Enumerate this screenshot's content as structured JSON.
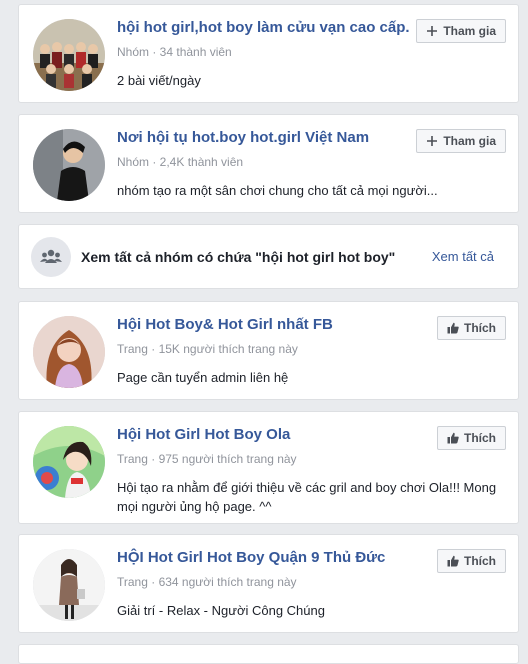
{
  "groups": [
    {
      "name": "hội hot girl,hot boy làm cửu vạn cao cấp.",
      "meta": "Nhóm · 34 thành viên",
      "desc": "2 bài viết/ngày",
      "button": "Tham gia",
      "avatar": "group-photo"
    },
    {
      "name": "Nơi hội tụ hot.boy hot.girl Việt Nam",
      "meta": "Nhóm · 2,4K thành viên",
      "desc": "nhóm tạo ra một sân chơi chung cho tất cả mọi người...",
      "button": "Tham gia",
      "avatar": "person-photo"
    }
  ],
  "see_all": {
    "text": "Xem tất cả nhóm có chứa \"hội hot girl hot boy\"",
    "link": "Xem tất cả",
    "icon": "group-icon"
  },
  "pages": [
    {
      "name": "Hội Hot Boy& Hot Girl nhất FB",
      "meta": "Trang · 15K người thích trang này",
      "desc": "Page cần tuyển admin liên hệ",
      "button": "Thích",
      "avatar": "girl-photo"
    },
    {
      "name": "Hội Hot Girl Hot Boy Ola",
      "meta": "Trang · 975 người thích trang này",
      "desc": "Hội tạo ra nhằm để giới thiệu về các gril and boy chơi Ola!!! Mong mọi người ủng hộ page. ^^",
      "button": "Thích",
      "avatar": "anime-photo"
    },
    {
      "name": "HỘI Hot Girl Hot Boy Quận 9 Thủ Đức",
      "meta": "Trang · 634 người thích trang này",
      "desc": "Giải trí - Relax - Người Công Chúng",
      "button": "Thích",
      "avatar": "woman-photo"
    }
  ],
  "colors": {
    "link": "#365899",
    "meta": "#90949c",
    "background": "#e9ebee"
  }
}
